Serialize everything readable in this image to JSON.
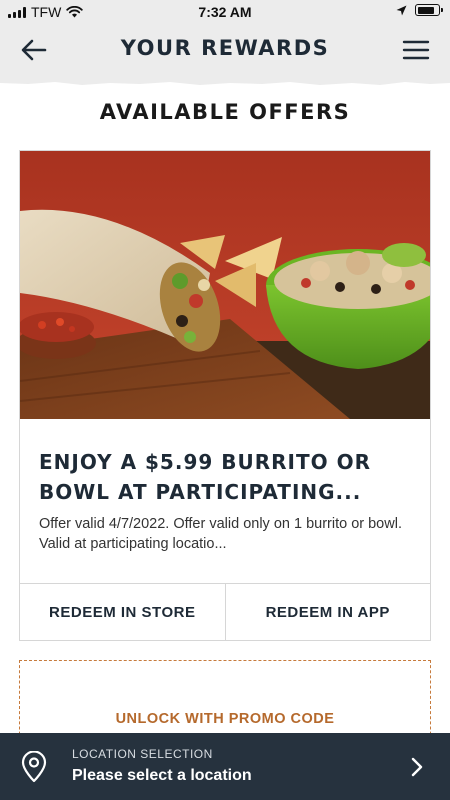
{
  "status_bar": {
    "carrier": "TFW",
    "time": "7:32 AM",
    "icons": [
      "signal-bars-icon",
      "wifi-icon",
      "location-arrow-icon",
      "battery-icon"
    ],
    "battery_level": 0.85
  },
  "header": {
    "title": "YOUR REWARDS",
    "back_icon": "back-arrow-icon",
    "menu_icon": "hamburger-menu-icon",
    "background": "#ececec"
  },
  "section": {
    "title": "AVAILABLE OFFERS"
  },
  "offer": {
    "image": "burrito-and-bowl-photo",
    "title": "ENJOY A $5.99 BURRITO OR BOWL AT PARTICIPATING...",
    "description": "Offer valid 4/7/2022.  Offer valid only on 1 burrito or bowl. Valid at participating locatio...",
    "actions": {
      "redeem_store": "REDEEM IN STORE",
      "redeem_app": "REDEEM IN APP"
    }
  },
  "promo": {
    "label": "UNLOCK WITH PROMO CODE",
    "border_color": "#c67a3c",
    "text_color": "#b5692c"
  },
  "location": {
    "label": "LOCATION SELECTION",
    "value": "Please select a location",
    "icons": [
      "location-pin-icon",
      "chevron-right-icon"
    ],
    "background": "#26323e"
  },
  "colors": {
    "brand_dark": "#1e2a36",
    "accent_orange": "#c67a3c"
  }
}
